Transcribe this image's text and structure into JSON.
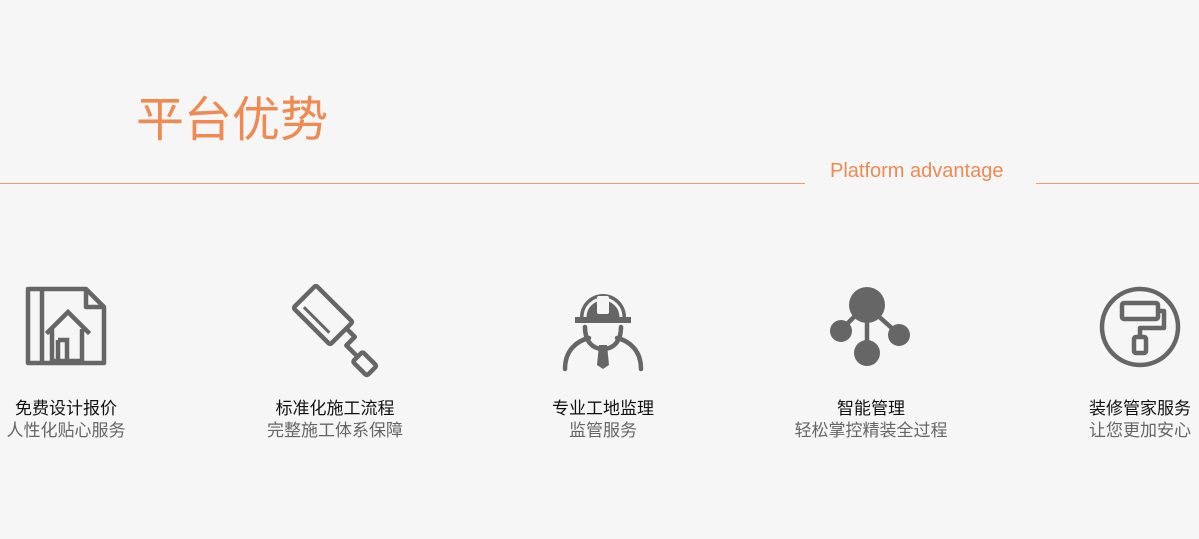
{
  "header": {
    "title": "平台优势",
    "subtitle": "Platform advantage"
  },
  "colors": {
    "accent": "#ef8a52",
    "rule": "#ef9a73",
    "icon": "#666666",
    "background": "#f6f6f6"
  },
  "features": [
    {
      "title": "免费设计报价",
      "desc": "人性化贴心服务",
      "icon": "house-blueprint-icon"
    },
    {
      "title": "标准化施工流程",
      "desc": "完整施工体系保障",
      "icon": "paint-roller-icon"
    },
    {
      "title": "专业工地监理",
      "desc": "监管服务",
      "icon": "construction-worker-icon"
    },
    {
      "title": "智能管理",
      "desc": "轻松掌控精装全过程",
      "icon": "network-nodes-icon"
    },
    {
      "title": "装修管家服务",
      "desc": "让您更加安心",
      "icon": "roller-circle-icon"
    }
  ]
}
